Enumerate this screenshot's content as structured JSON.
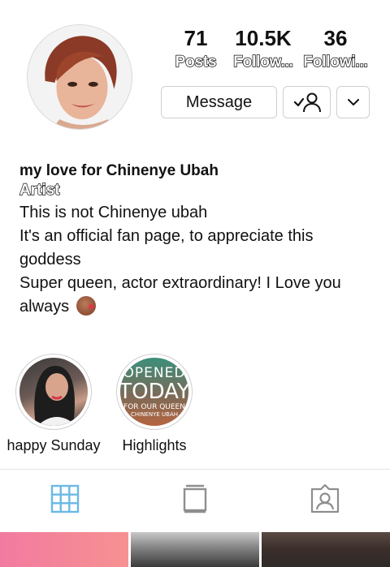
{
  "profile": {
    "stats": [
      {
        "value": "71",
        "label": "Posts"
      },
      {
        "value": "10.5K",
        "label": "Follow..."
      },
      {
        "value": "36",
        "label": "Followi..."
      }
    ],
    "buttons": {
      "message": "Message",
      "follow_icon": "person-check-icon",
      "more_icon": "chevron-down-icon"
    }
  },
  "bio": {
    "name": "my love for Chinenye Ubah",
    "category": "Artist",
    "lines": [
      "This is not Chinenye ubah",
      "It's an official fan page, to appreciate this",
      "goddess",
      "Super queen, actor extraordinary! I Love you",
      "always"
    ],
    "emoji": "kissing-face-emoji"
  },
  "highlights": [
    {
      "label": "happy Sunday"
    },
    {
      "label": "Highlights",
      "cover_text": [
        "OPENED",
        "TODAY",
        "FOR OUR QUEEN",
        "CHINENYE UBAH"
      ]
    }
  ],
  "tabs": [
    {
      "icon": "grid-icon",
      "active": true
    },
    {
      "icon": "igtv-icon",
      "active": false
    },
    {
      "icon": "tagged-icon",
      "active": false
    }
  ],
  "colors": {
    "active_tab": "#6ab8e6",
    "inactive_tab": "#8e8e8e"
  }
}
